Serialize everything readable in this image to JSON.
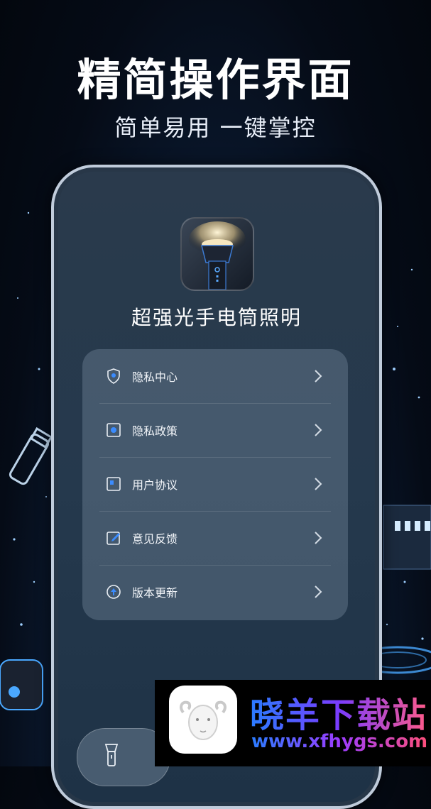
{
  "hero": {
    "title": "精简操作界面",
    "subtitle": "简单易用 一键掌控"
  },
  "app": {
    "name": "超强光手电筒照明",
    "icon": "flashlight-icon"
  },
  "menu": {
    "items": [
      {
        "label": "隐私中心",
        "icon": "shield-icon"
      },
      {
        "label": "隐私政策",
        "icon": "privacy-doc-icon"
      },
      {
        "label": "用户协议",
        "icon": "agreement-icon"
      },
      {
        "label": "意见反馈",
        "icon": "edit-icon"
      },
      {
        "label": "版本更新",
        "icon": "update-icon"
      }
    ]
  },
  "bottom_nav": {
    "icon": "flashlight-icon"
  },
  "watermark": {
    "name": "晓羊下载站",
    "url": "www.xfhygs.com",
    "icon": "sheep-logo-icon"
  },
  "colors": {
    "background": "#050b16",
    "accent": "#5aaaff"
  }
}
